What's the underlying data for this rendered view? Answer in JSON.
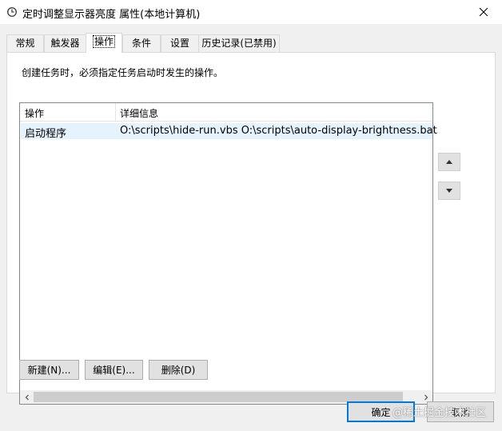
{
  "window": {
    "title": "定时调整显示器亮度 属性(本地计算机)",
    "icon": "clock-icon",
    "close_icon": "close-icon"
  },
  "tabs": [
    {
      "label": "常规",
      "active": false
    },
    {
      "label": "触发器",
      "active": false
    },
    {
      "label": "操作",
      "active": true
    },
    {
      "label": "条件",
      "active": false
    },
    {
      "label": "设置",
      "active": false
    },
    {
      "label": "历史记录(已禁用)",
      "active": false
    }
  ],
  "panel": {
    "description": "创建任务时，必须指定任务启动时发生的操作。"
  },
  "actions_list": {
    "columns": [
      "操作",
      "详细信息"
    ],
    "rows": [
      {
        "action": "启动程序",
        "details": "O:\\scripts\\hide-run.vbs O:\\scripts\\auto-display-brightness.bat"
      }
    ]
  },
  "buttons": {
    "new": "新建(N)...",
    "edit": "编辑(E)...",
    "delete": "删除(D)",
    "ok": "确定",
    "cancel": "取消"
  },
  "watermark": "@稀土掘金技术社区",
  "colors": {
    "selection": "#e5f3ff",
    "default_button_border": "#0078d7",
    "window_background": "#f0f0f0"
  }
}
